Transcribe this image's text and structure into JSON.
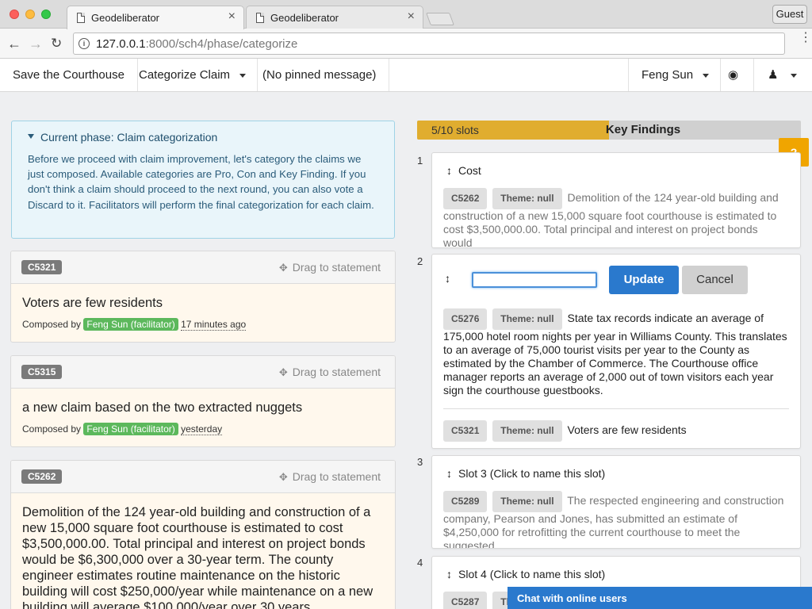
{
  "browser": {
    "tabs": [
      {
        "title": "Geodeliberator",
        "active": true
      },
      {
        "title": "Geodeliberator",
        "active": false
      }
    ],
    "close_glyph": "×",
    "guest_label": "Guest",
    "url_host": "127.0.0.1",
    "url_rest": ":8000/sch4/phase/categorize",
    "back_glyph": "←",
    "forward_glyph": "→",
    "reload_glyph": "↻",
    "info_glyph": "i",
    "menu_glyph": "⋮"
  },
  "navbar": {
    "project": "Save the Courthouse",
    "phase_menu": "Categorize Claim",
    "pinned": "(No pinned message)",
    "user": "Feng Sun",
    "dashboard_glyph": "◉",
    "account_glyph": "♟"
  },
  "phase": {
    "title": "Current phase: Claim categorization",
    "text": "Before we proceed with claim improvement, let's category the claims we just composed. Available categories are Pro, Con and Key Finding. If you don't think a claim should proceed to the next round, you can also vote a Discard to it. Facilitators will perform the final categorization for each claim."
  },
  "claims": [
    {
      "id": "C5321",
      "drag": "Drag to statement",
      "text": "Voters are few residents",
      "composed_by": "Composed by",
      "author": "Feng Sun (facilitator)",
      "time": "17 minutes ago"
    },
    {
      "id": "C5315",
      "drag": "Drag to statement",
      "text": "a new claim based on the two extracted nuggets",
      "composed_by": "Composed by",
      "author": "Feng Sun (facilitator)",
      "time": "yesterday"
    },
    {
      "id": "C5262",
      "drag": "Drag to statement",
      "text": "Demolition of the 124 year-old building and construction of a new 15,000 square foot courthouse is estimated to cost $3,500,000.00. Total principal and interest on project bonds would be $6,300,000 over a 30-year term. The county engineer estimates routine maintenance on the historic building will cost $250,000/year while maintenance on a new building will average $100,000/year over 30 years."
    }
  ],
  "key_findings": {
    "slots_used": 5,
    "slots_total": 10,
    "slot_count_text": "5/10 slots",
    "label": "Key Findings",
    "help": "?",
    "move_glyph": "✥",
    "updown_glyph": "↕",
    "slots": [
      {
        "number": "1",
        "title": "Cost",
        "items": [
          {
            "id": "C5262",
            "theme": "Theme: null",
            "text": "Demolition of the 124 year-old building and construction of a new 15,000 square foot courthouse is estimated to cost $3,500,000.00. Total principal and interest on project bonds would"
          }
        ]
      },
      {
        "number": "2",
        "editing": true,
        "input_value": "",
        "update_label": "Update",
        "cancel_label": "Cancel",
        "items": [
          {
            "id": "C5276",
            "theme": "Theme: null",
            "text": "State tax records indicate an average of 175,000 hotel room nights per year in Williams County. This translates to an average of 75,000 tourist visits per year to the County as estimated by the Chamber of Commerce. The Courthouse office manager reports an average of 2,000 out of town visitors each year sign the courthouse guestbooks."
          },
          {
            "id": "C5321",
            "theme": "Theme: null",
            "text": "Voters are few residents"
          }
        ]
      },
      {
        "number": "3",
        "title": "Slot 3 (Click to name this slot)",
        "items": [
          {
            "id": "C5289",
            "theme": "Theme: null",
            "text": "The respected engineering and construction company, Pearson and Jones, has submitted an estimate of $4,250,000 for retrofitting the current courthouse to meet the suggested"
          }
        ]
      },
      {
        "number": "4",
        "title": "Slot 4 (Click to name this slot)",
        "items": [
          {
            "id": "C5287",
            "theme": "Theme: null",
            "text": ""
          }
        ]
      }
    ]
  },
  "chat": {
    "label": "Chat with online users"
  },
  "colors": {
    "accent_blue": "#2a79cd",
    "slot_fill": "#e0ad2f",
    "help_orange": "#f0a500",
    "user_green": "#5cb85c"
  }
}
